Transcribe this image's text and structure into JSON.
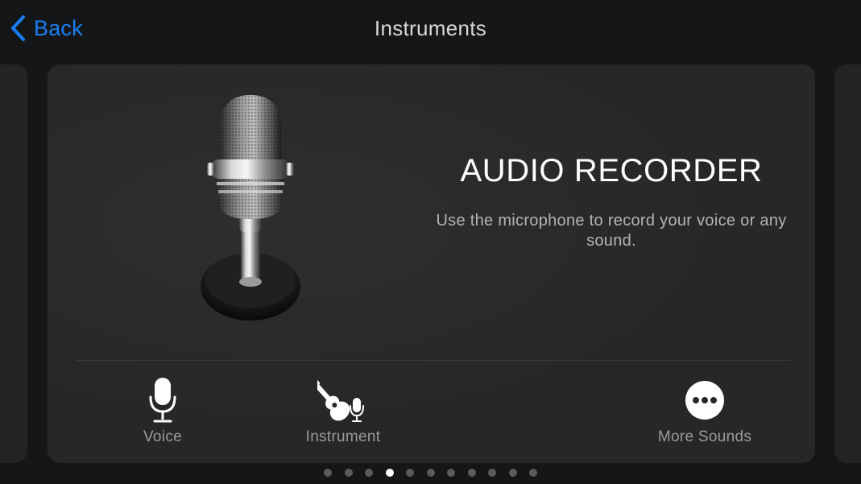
{
  "nav": {
    "back_label": "Back",
    "title": "Instruments"
  },
  "card": {
    "title": "AUDIO RECORDER",
    "description": "Use the microphone to record your voice or any sound.",
    "illustration_icon": "vintage-microphone-icon"
  },
  "options": [
    {
      "label": "Voice",
      "icon": "microphone-icon"
    },
    {
      "label": "Instrument",
      "icon": "guitar-microphone-icon"
    },
    {
      "label": "More Sounds",
      "icon": "ellipsis-circle-icon"
    }
  ],
  "pager": {
    "page_count": 11,
    "current_page": 4
  },
  "colors": {
    "background": "#151617",
    "card": "#262728",
    "accent": "#1a7ff5",
    "title_text": "#d8d8d8",
    "secondary_text": "#9a9b9d"
  }
}
